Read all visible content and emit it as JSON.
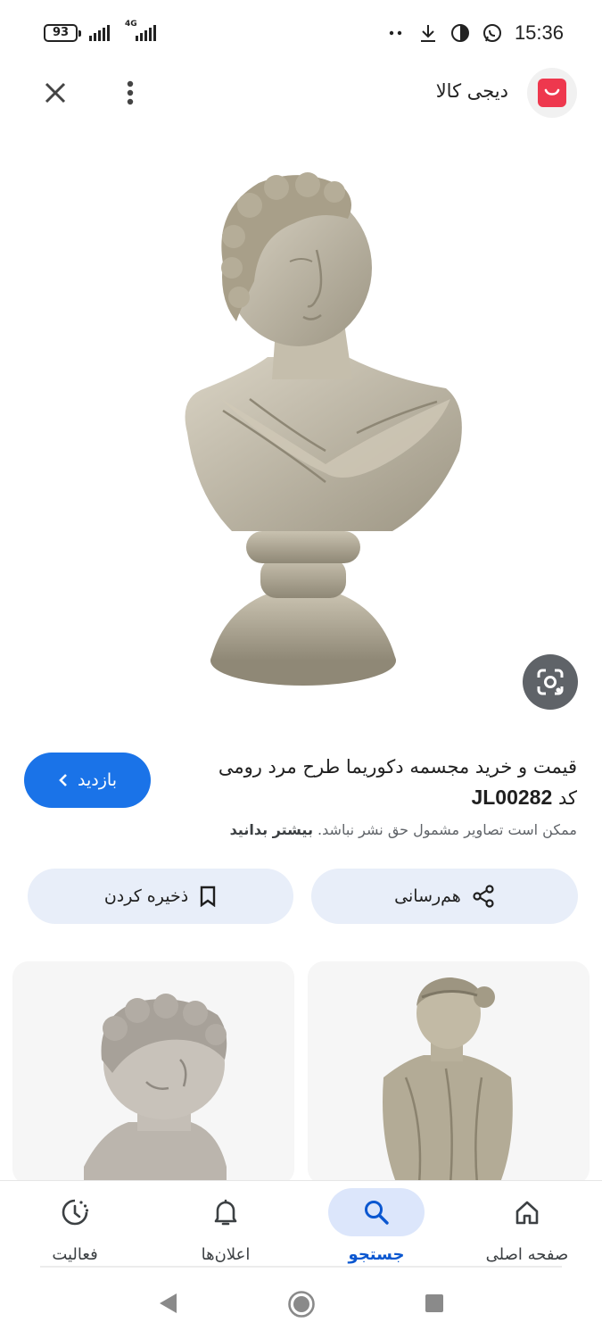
{
  "status_bar": {
    "battery": "93",
    "network": "4G",
    "time": "15:36",
    "icons": [
      "dots-icon",
      "download-icon",
      "vpn-icon",
      "whatsapp-icon"
    ]
  },
  "app_bar": {
    "site_name": "دیجی کالا",
    "close_icon": "close-icon",
    "more_icon": "more-vert-icon",
    "brand_color": "#ee384e"
  },
  "result": {
    "title_line": "قیمت و خرید مجسمه دکوریما طرح مرد رومی",
    "title_code_prefix": "کد",
    "title_code": "JL00282",
    "visit_label": "بازدید",
    "copyright_text": "ممکن است تصاویر مشمول حق نشر نباشد.",
    "learn_more": "بیشتر بدانید"
  },
  "actions": {
    "share_label": "هم‌رسانی",
    "save_label": "ذخیره کردن"
  },
  "bottom_nav": {
    "items": [
      {
        "label": "صفحه اصلی",
        "icon": "home-icon",
        "active": false
      },
      {
        "label": "جستجو",
        "icon": "search-icon",
        "active": true
      },
      {
        "label": "اعلان‌ها",
        "icon": "bell-icon",
        "active": false
      },
      {
        "label": "فعالیت",
        "icon": "activity-icon",
        "active": false
      }
    ]
  },
  "colors": {
    "accent": "#1a73e8",
    "active_nav": "#0b57d0",
    "pill_bg": "#e8eef9"
  }
}
